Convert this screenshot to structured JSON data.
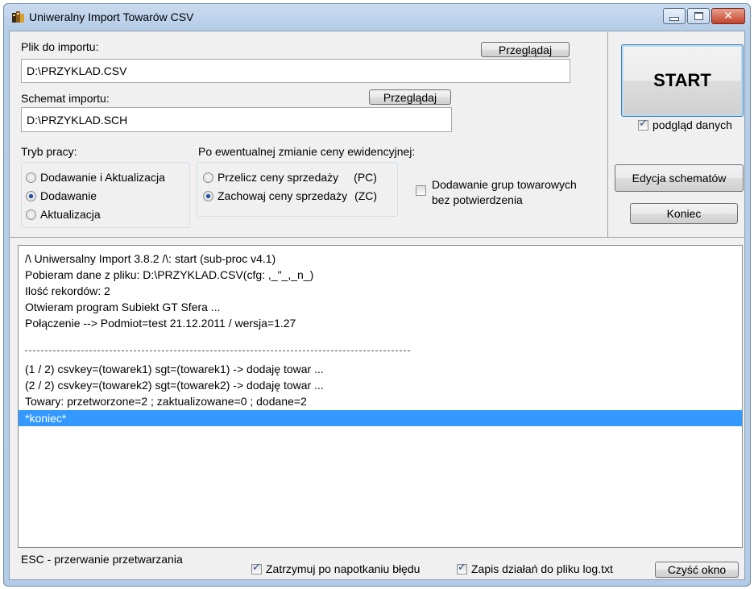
{
  "window": {
    "title": "Uniweralny Import Towarów  CSV",
    "controls": [
      "minimize",
      "maximize",
      "close"
    ]
  },
  "import_file": {
    "label": "Plik do importu:",
    "browse_label": "Przeglądaj",
    "value": "D:\\PRZYKLAD.CSV"
  },
  "schema": {
    "label": "Schemat importu:",
    "browse_label": "Przeglądaj",
    "value": "D:\\PRZYKLAD.SCH"
  },
  "mode": {
    "label": "Tryb pracy:",
    "options": [
      {
        "label": "Dodawanie i Aktualizacja",
        "selected": false
      },
      {
        "label": "Dodawanie",
        "selected": true
      },
      {
        "label": "Aktualizacja",
        "selected": false
      }
    ]
  },
  "price": {
    "label": "Po ewentualnej zmianie ceny ewidencyjnej:",
    "options": [
      {
        "label": "Przelicz ceny sprzedaży",
        "code": "(PC)",
        "selected": false
      },
      {
        "label": "Zachowaj ceny sprzedaży",
        "code": "(ZC)",
        "selected": true
      }
    ]
  },
  "groups_checkbox": {
    "line1": "Dodawanie grup towarowych",
    "line2": "bez potwierdzenia",
    "checked": false
  },
  "start_button": "START",
  "preview_checkbox": {
    "label": "podgląd danych",
    "checked": true
  },
  "edit_schemas_button": "Edycja schematów",
  "end_button": "Koniec",
  "log": {
    "lines": [
      "/\\ Uniwersalny Import 3.8.2 /\\: start (sub-proc v4.1)",
      "Pobieram dane z pliku: D:\\PRZYKLAD.CSV(cfg: ,_\"_,_n_)",
      "Ilość rekordów: 2",
      "Otwieram program Subiekt GT Sfera ...",
      "Połączenie --> Podmiot=test 21.12.2011 / wersja=1.27"
    ],
    "lines_after": [
      "(1 / 2) csvkey=(towarek1) sgt=(towarek1) -> dodaję towar ...",
      "(2 / 2) csvkey=(towarek2) sgt=(towarek2) -> dodaję towar ...",
      "Towary: przetworzone=2 ;  zaktualizowane=0 ;  dodane=2"
    ],
    "selected_line": "*koniec*"
  },
  "footer": {
    "esc_hint": "ESC - przerwanie przetwarzania",
    "stop_on_error": {
      "label": "Zatrzymuj po napotkaniu błędu",
      "checked": true
    },
    "log_to_file": {
      "label": "Zapis działań do pliku log.txt",
      "checked": true
    },
    "clear_button": "Czyść okno"
  }
}
